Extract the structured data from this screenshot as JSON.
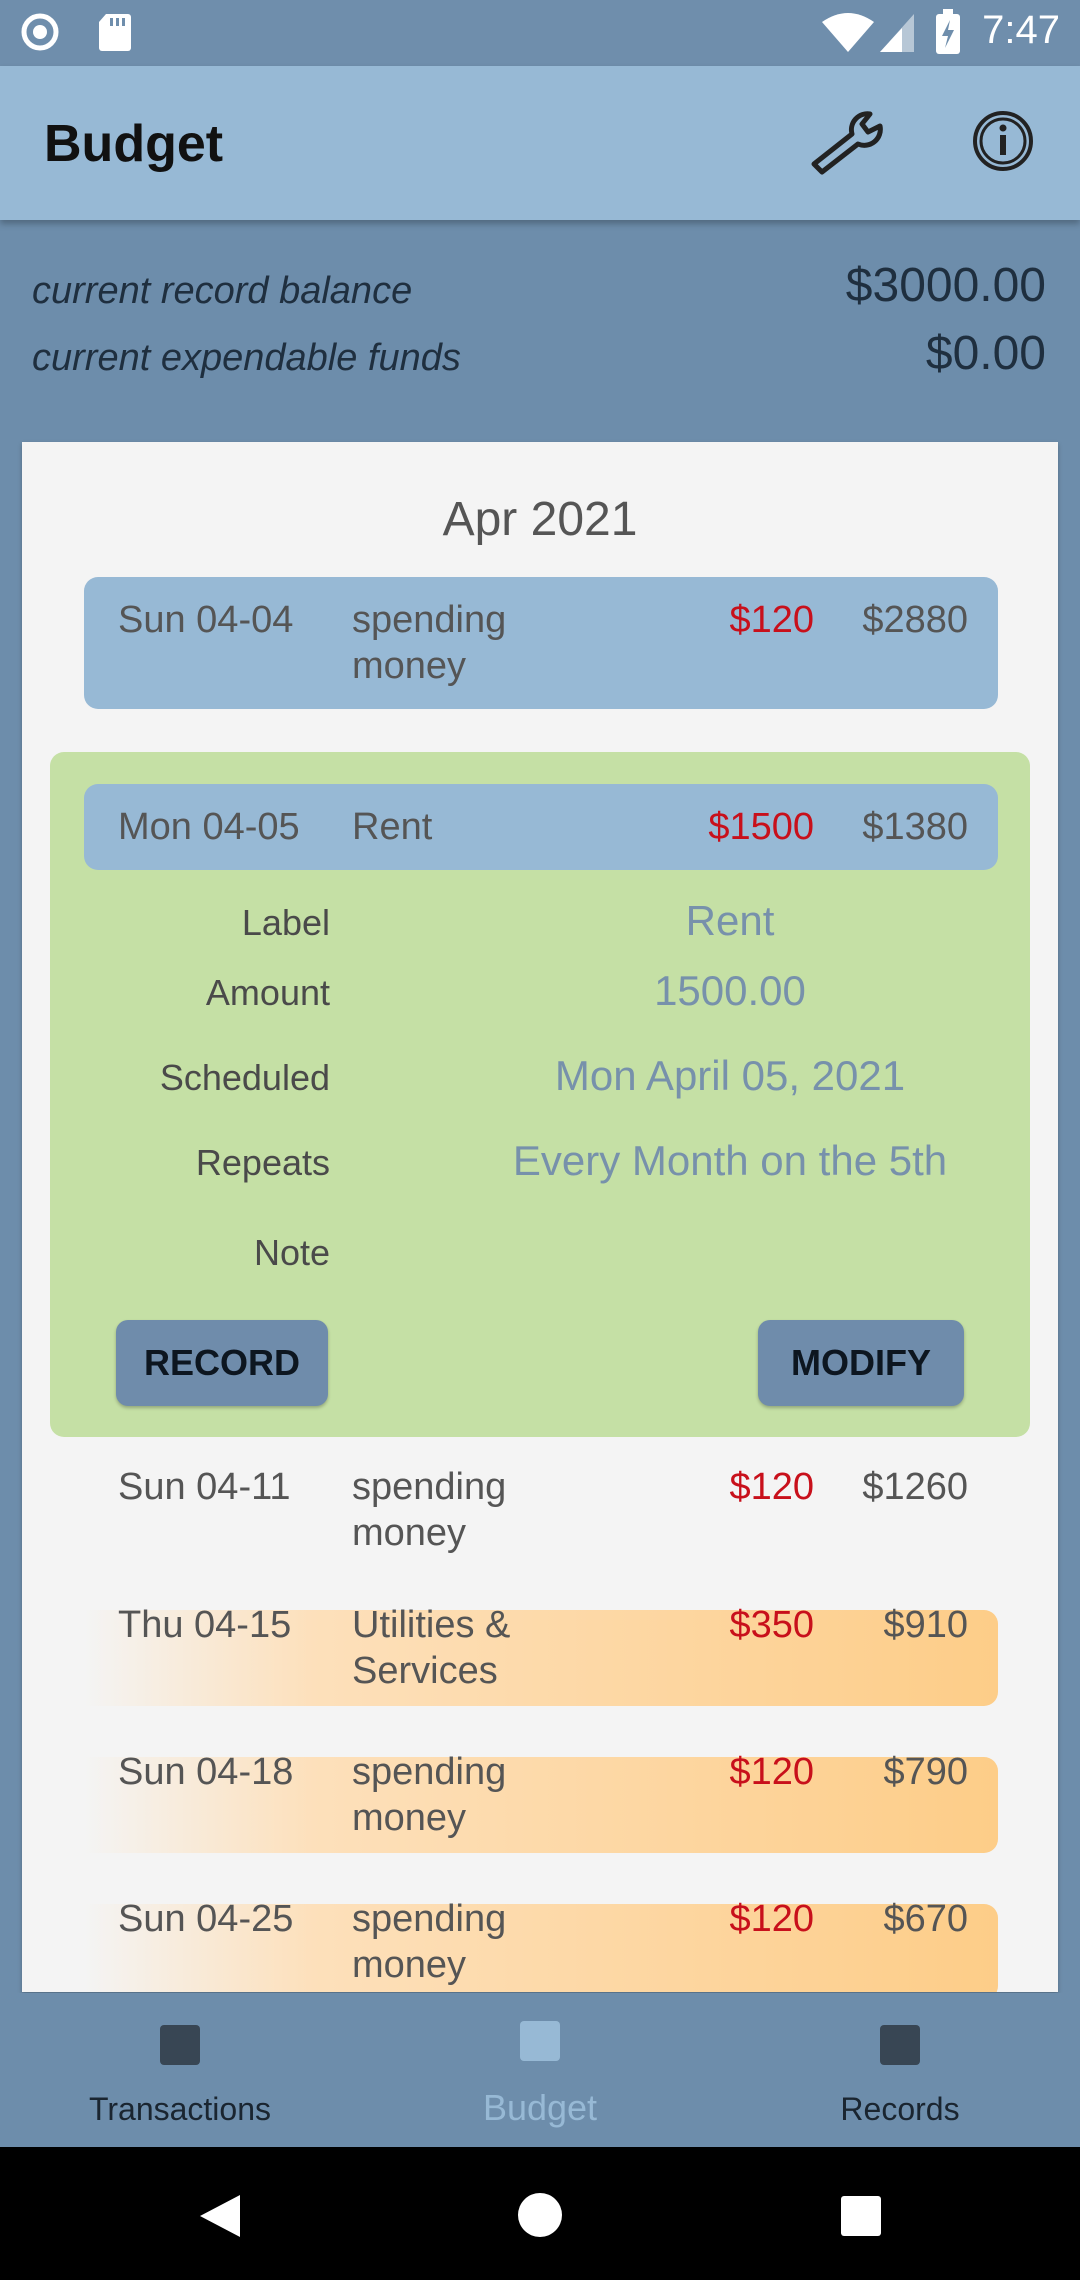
{
  "status_bar": {
    "time": "7:47"
  },
  "app_bar": {
    "title": "Budget",
    "settings_icon": "wrench-icon",
    "info_icon": "info-icon"
  },
  "summary": {
    "balance_label": "current record balance",
    "balance_value": "$3000.00",
    "funds_label": "current expendable funds",
    "funds_value": "$0.00"
  },
  "month": "Apr 2021",
  "rows": [
    {
      "date": "Sun 04-04",
      "label_line1": "spending",
      "label_line2": "money",
      "amount": "$120",
      "balance": "$2880"
    },
    {
      "date": "Mon 04-05",
      "label_line1": "Rent",
      "label_line2": "",
      "amount": "$1500",
      "balance": "$1380"
    },
    {
      "date": "Sun 04-11",
      "label_line1": "spending",
      "label_line2": "money",
      "amount": "$120",
      "balance": "$1260"
    },
    {
      "date": "Thu 04-15",
      "label_line1": "Utilities &",
      "label_line2": "Services",
      "amount": "$350",
      "balance": "$910"
    },
    {
      "date": "Sun 04-18",
      "label_line1": "spending",
      "label_line2": "money",
      "amount": "$120",
      "balance": "$790"
    },
    {
      "date": "Sun 04-25",
      "label_line1": "spending",
      "label_line2": "money",
      "amount": "$120",
      "balance": "$670"
    }
  ],
  "detail": {
    "label_label": "Label",
    "label_value": "Rent",
    "amount_label": "Amount",
    "amount_value": "1500.00",
    "scheduled_label": "Scheduled",
    "scheduled_value": "Mon April 05, 2021",
    "repeats_label": "Repeats",
    "repeats_value": "Every Month on the 5th",
    "note_label": "Note",
    "note_value": "",
    "record_button": "RECORD",
    "modify_button": "MODIFY"
  },
  "bottom_nav": {
    "items": [
      {
        "label": "Transactions",
        "active": false
      },
      {
        "label": "Budget",
        "active": true
      },
      {
        "label": "Records",
        "active": false
      }
    ]
  },
  "colors": {
    "accent_blue": "#97b9d5",
    "detail_green": "#c5e0a5",
    "negative_red": "#c8101b"
  }
}
